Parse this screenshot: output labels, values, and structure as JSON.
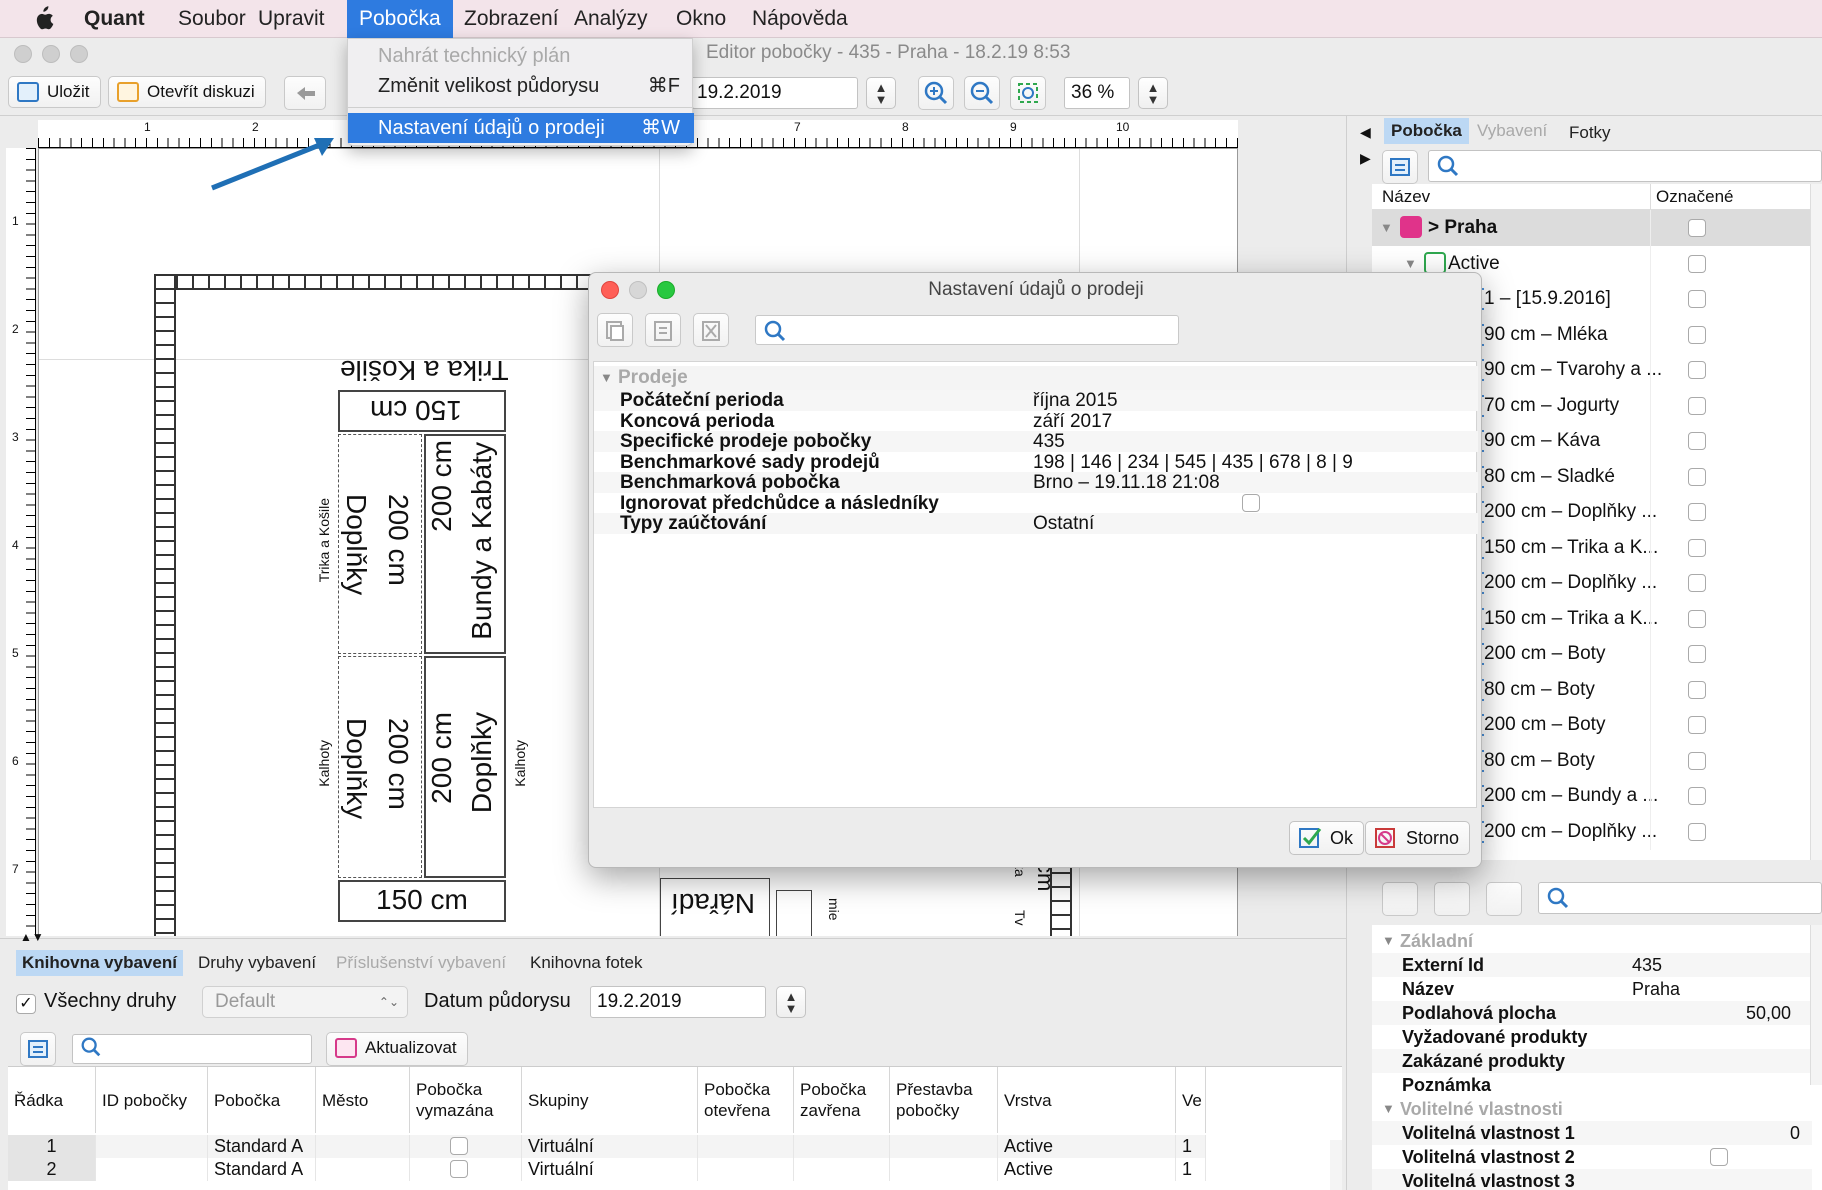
{
  "menubar": {
    "app": "Quant",
    "items": [
      "Soubor",
      "Upravit",
      "Pobočka",
      "Zobrazení",
      "Analýzy",
      "Okno",
      "Nápověda"
    ],
    "active_item": "Pobočka"
  },
  "window": {
    "title": "Editor pobočky - 435 - Praha  - 18.2.19 8:53"
  },
  "toolbar": {
    "save_label": "Uložit",
    "discussion_label": "Otevřít diskuzi",
    "date_value": "19.2.2019",
    "zoom_value": "36 %"
  },
  "dropdown": {
    "items": [
      {
        "label": "Nahrát technický plán",
        "shortcut": "",
        "state": "disabled"
      },
      {
        "label": "Změnit velikost půdorysu",
        "shortcut": "⌘F",
        "state": "normal"
      },
      {
        "label": "Nastavení údajů o prodeji",
        "shortcut": "⌘W",
        "state": "highlighted"
      }
    ]
  },
  "ruler": {
    "top": [
      "1",
      "2",
      "7",
      "8",
      "9",
      "10"
    ],
    "left": [
      "1",
      "2",
      "3",
      "4",
      "5",
      "6",
      "7"
    ]
  },
  "floorplan": {
    "labels": {
      "top_section": "Trika a Košile",
      "top_size": "150 cm",
      "col1_size": "200 cm",
      "col1_name": "Doplňky",
      "col1_side": "Trika a Košile",
      "col2_size": "200 cm",
      "col2_name": "Bundy a Kabáty",
      "col3_size": "200 cm",
      "col3_name": "Doplňky",
      "col3_side": "Kalhoty",
      "col4_size": "200 cm",
      "col4_name": "Doplňky",
      "col4_side": "Kalhoty",
      "bottom_size": "150 cm",
      "tools": "Nářadí",
      "frag1": "mie",
      "frag2": "cm",
      "frag3": "ka",
      "frag4": "Tv"
    }
  },
  "dialog": {
    "title": "Nastavení údajů o prodeji",
    "section": "Prodeje",
    "rows": [
      {
        "key": "Počáteční perioda",
        "value": "října 2015"
      },
      {
        "key": "Koncová perioda",
        "value": "září 2017"
      },
      {
        "key": "Specifické prodeje pobočky",
        "value": "435"
      },
      {
        "key": "Benchmarkové sady prodejů",
        "value": "198 | 146 | 234 | 545 | 435 | 678 | 8 | 9"
      },
      {
        "key": "Benchmarková pobočka",
        "value": "Brno – 19.11.18 21:08"
      },
      {
        "key": "Ignorovat předchůdce a následníky",
        "value": ""
      },
      {
        "key": "Typy zaúčtování",
        "value": "Ostatní"
      }
    ],
    "ok_label": "Ok",
    "cancel_label": "Storno"
  },
  "right_panel": {
    "tabs": [
      "Pobočka",
      "Vybavení",
      "Fotky"
    ],
    "active_tab": "Pobočka",
    "tree_headers": {
      "name": "Název",
      "marked": "Označené"
    },
    "tree_rows": [
      {
        "label": "> Praha",
        "level": 0
      },
      {
        "label": "Active",
        "level": 1
      },
      {
        "label": "1 – [15.9.2016]",
        "level": 2
      },
      {
        "label": "90 cm – Mléka",
        "level": 3
      },
      {
        "label": "90 cm – Tvarohy a ...",
        "level": 3
      },
      {
        "label": "70 cm – Jogurty",
        "level": 3
      },
      {
        "label": "90 cm – Káva",
        "level": 3
      },
      {
        "label": "80 cm – Sladké",
        "level": 3
      },
      {
        "label": "200 cm – Doplňky ...",
        "level": 3
      },
      {
        "label": "150 cm – Trika a K...",
        "level": 3
      },
      {
        "label": "200 cm – Doplňky ...",
        "level": 3
      },
      {
        "label": "150 cm – Trika a K...",
        "level": 3
      },
      {
        "label": "200 cm – Boty",
        "level": 3
      },
      {
        "label": "80 cm – Boty",
        "level": 3
      },
      {
        "label": "200 cm – Boty",
        "level": 3
      },
      {
        "label": "80 cm – Boty",
        "level": 3
      },
      {
        "label": "200 cm – Bundy a ...",
        "level": 3
      },
      {
        "label": "200 cm – Doplňky ...",
        "level": 3
      }
    ],
    "props": {
      "section_basic": "Základní",
      "rows": [
        {
          "key": "Externí Id",
          "value": "435"
        },
        {
          "key": "Název",
          "value": "Praha"
        },
        {
          "key": "Podlahová plocha",
          "value": "50,00"
        },
        {
          "key": "Vyžadované produkty",
          "value": ""
        },
        {
          "key": "Zakázané produkty",
          "value": ""
        },
        {
          "key": "Poznámka",
          "value": ""
        }
      ],
      "section_optional": "Volitelné vlastnosti",
      "optional_rows": [
        {
          "key": "Volitelná vlastnost 1",
          "value": "0"
        },
        {
          "key": "Volitelná vlastnost 2",
          "value": ""
        },
        {
          "key": "Volitelná vlastnost 3",
          "value": ""
        }
      ]
    }
  },
  "bottom_panel": {
    "tabs": [
      "Knihovna vybavení",
      "Druhy vybavení",
      "Příslušenství vybavení",
      "Knihovna fotek"
    ],
    "active_tab": "Knihovna vybavení",
    "all_types_label": "Všechny druhy",
    "default_select": "Default",
    "date_label": "Datum půdorysu",
    "date_value": "19.2.2019",
    "refresh_label": "Aktualizovat",
    "columns": [
      "Řádka",
      "ID pobočky",
      "Pobočka",
      "Město",
      "Pobočka vymazána",
      "Skupiny",
      "Pobočka otevřena",
      "Pobočka zavřena",
      "Přestavba pobočky",
      "Vrstva",
      "Ve"
    ],
    "rows": [
      [
        "1",
        "",
        "Standard A",
        "",
        "",
        "Virtuální",
        "",
        "",
        "",
        "Active",
        "1"
      ],
      [
        "2",
        "",
        "Standard A",
        "",
        "",
        "Virtuální",
        "",
        "",
        "",
        "Active",
        "1"
      ]
    ]
  },
  "colors": {
    "accent": "#2e7be0",
    "menubar_bg": "#f3e4ea",
    "tab_active": "#bcd8f4",
    "arrow": "#1f6fb5"
  }
}
